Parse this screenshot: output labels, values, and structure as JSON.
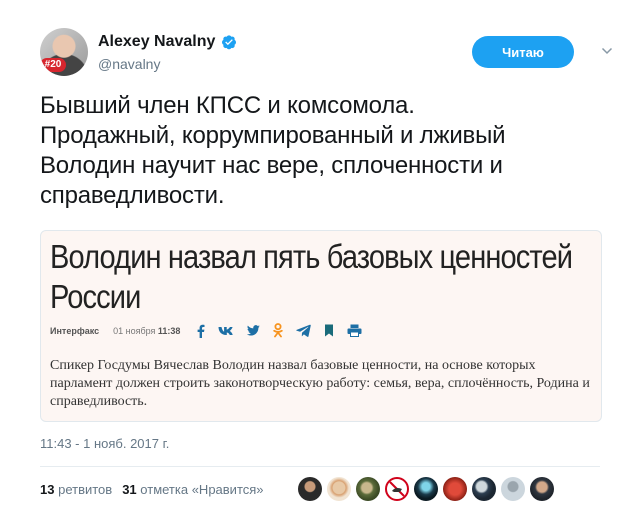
{
  "author": {
    "name": "Alexey Navalny",
    "handle": "@navalny",
    "avatar_badge": "#20"
  },
  "follow_button_label": "Читаю",
  "tweet_text": "Бывший член КПСС и комсомола.\nПродажный, коррумпированный и лживый\nВолодин научит нас вере, сплоченности и\nсправедливости.",
  "card": {
    "title": "Володин назвал пять базовых ценностей России",
    "source": "Интерфакс",
    "date": "01 ноября",
    "time": "11:38",
    "description": "Спикер Госдумы Вячеслав Володин назвал базовые ценности, на основе которых парламент должен строить законотворческую работу: семья, вера, сплочённость, Родина и справедливость.",
    "share_icons": [
      "facebook-icon",
      "vk-icon",
      "twitter-icon",
      "odnoklassniki-icon",
      "telegram-icon",
      "bookmark-icon",
      "print-icon"
    ]
  },
  "timestamp": "11:43 - 1 нояб. 2017 г.",
  "stats": {
    "retweets_count": "13",
    "retweets_label": "ретвитов",
    "likes_count": "31",
    "likes_label": "отметка «Нравится»"
  },
  "colors": {
    "accent": "#1da1f2",
    "muted": "#657786",
    "card_bg": "#fdf6f3",
    "share_blue": "#1d6fa5",
    "share_orange": "#f7931e",
    "share_red": "#c8102e"
  }
}
